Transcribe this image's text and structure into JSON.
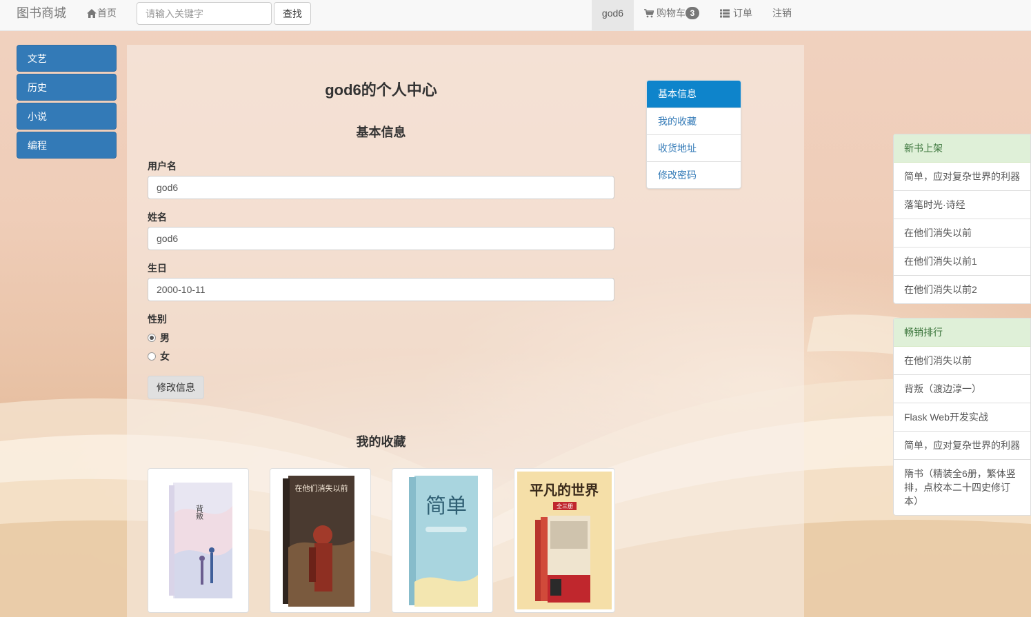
{
  "nav": {
    "brand": "图书商城",
    "home": "首页",
    "search_placeholder": "请输入关键字",
    "search_button": "查找",
    "user": "god6",
    "cart_label": "购物车",
    "cart_count": "3",
    "orders": "订单",
    "logout": "注销"
  },
  "categories": [
    "文艺",
    "历史",
    "小说",
    "编程"
  ],
  "profile": {
    "title": "god6的个人中心",
    "basic_info_title": "基本信息",
    "username_label": "用户名",
    "username_value": "god6",
    "name_label": "姓名",
    "name_value": "god6",
    "birthday_label": "生日",
    "birthday_value": "2000-10-11",
    "gender_label": "性别",
    "gender_options": [
      "男",
      "女"
    ],
    "gender_selected": "男",
    "update_button": "修改信息",
    "favorites_title": "我的收藏"
  },
  "profile_nav": [
    "基本信息",
    "我的收藏",
    "收货地址",
    "修改密码"
  ],
  "favorites": [
    {
      "cover_text": "背叛"
    },
    {
      "cover_text": "在他们消失以前"
    },
    {
      "cover_text": "简单"
    },
    {
      "cover_text": "平凡的世界",
      "cover_sub": "全三册"
    }
  ],
  "new_books": {
    "title": "新书上架",
    "items": [
      "简单，应对复杂世界的利器",
      "落笔时光·诗经",
      "在他们消失以前",
      "在他们消失以前1",
      "在他们消失以前2"
    ]
  },
  "bestsellers": {
    "title": "畅销排行",
    "items": [
      "在他们消失以前",
      "背叛（渡边淳一）",
      "Flask Web开发实战",
      "简单，应对复杂世界的利器",
      "隋书（精装全6册，繁体竖排，点校本二十四史修订本）"
    ]
  },
  "colors": {
    "primary": "#337ab7",
    "nav_active": "#0e84cb",
    "panel_success": "#dff0d8"
  }
}
